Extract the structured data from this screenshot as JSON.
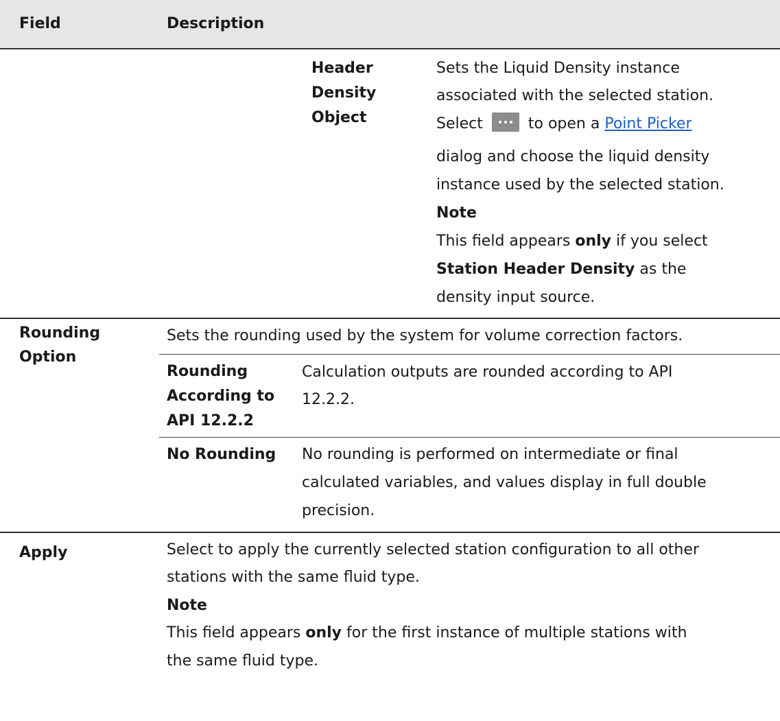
{
  "header": {
    "col_field": "Field",
    "col_description": "Description"
  },
  "header_density": {
    "name_line1": "Header",
    "name_line2": "Density",
    "name_line3": "Object",
    "desc_line1": "Sets the Liquid Density instance",
    "desc_line2": "associated with the selected station.",
    "select_word": "Select",
    "to_open": "to open a",
    "point_picker_link": "Point Picker",
    "desc_line4": "dialog and choose the liquid density",
    "desc_line5": "instance used by the selected station.",
    "note_label": "Note",
    "note_prefix": "This field appears",
    "note_only": "only",
    "note_after_only": "if you select",
    "note_bold": "Station Header Density",
    "note_after_bold": "as the",
    "note_last": "density input source."
  },
  "rounding": {
    "field_line1": "Rounding",
    "field_line2": "Option",
    "desc": "Sets the rounding used by the system for volume correction factors.",
    "api_name_line1": "Rounding",
    "api_name_line2": "According to",
    "api_name_line3": "API 12.2.2",
    "api_desc_line1": "Calculation outputs are rounded according to API",
    "api_desc_line2": "12.2.2.",
    "none_name": "No Rounding",
    "none_desc_line1": "No rounding is performed on intermediate or final",
    "none_desc_line2": "calculated variables, and values display in full double",
    "none_desc_line3": "precision."
  },
  "apply": {
    "field": "Apply",
    "desc_line1": "Select to apply the currently selected station configuration to all other",
    "desc_line2": "stations with the same fluid type.",
    "note_label": "Note",
    "note_prefix": "This field appears",
    "note_only": "only",
    "note_after_only": "for the first instance of multiple stations with",
    "note_line2": "the same fluid type."
  },
  "icons": {
    "ellipsis_button": "ellipsis-button-icon"
  }
}
